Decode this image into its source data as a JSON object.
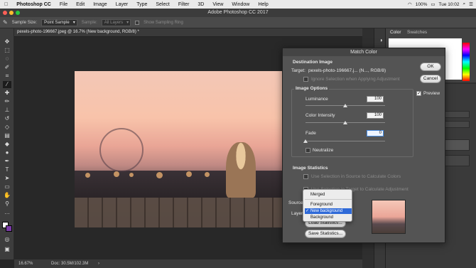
{
  "menubar": {
    "apple": "",
    "app_name": "Photoshop CC",
    "items": [
      "File",
      "Edit",
      "Image",
      "Layer",
      "Type",
      "Select",
      "Filter",
      "3D",
      "View",
      "Window",
      "Help"
    ],
    "battery": "100%",
    "clock": "Tue 10:02"
  },
  "window": {
    "title": "Adobe Photoshop CC 2017"
  },
  "options_bar": {
    "sample_size_label": "Sample Size:",
    "sample_size_value": "Point Sample",
    "sample_label": "Sample:",
    "sample_value": "All Layers",
    "sampling_ring_label": "Show Sampling Ring"
  },
  "document": {
    "tab_title": "pexels-photo-196667.jpeg @ 16.7% (New background, RGB/8) *",
    "zoom": "16.67%",
    "doc_size": "Doc: 30.5M/102.3M"
  },
  "panels": {
    "color_tab": "Color",
    "swatches_tab": "Swatches"
  },
  "dialog": {
    "title": "Match Color",
    "destination_heading": "Destination Image",
    "target_label": "Target:",
    "target_value": "pexels-photo-196667.j... (N..., RGB/8)",
    "ignore_selection_label": "Ignore Selection when Applying Adjustment",
    "image_options_heading": "Image Options",
    "luminance_label": "Luminance",
    "luminance_value": "100",
    "luminance_fraction": 0.5,
    "intensity_label": "Color Intensity",
    "intensity_value": "100",
    "intensity_fraction": 0.5,
    "fade_label": "Fade",
    "fade_value": "0",
    "fade_fraction": 0,
    "neutralize_label": "Neutralize",
    "image_stats_heading": "Image Statistics",
    "use_sel_source_label": "Use Selection in Source to Calculate Colors",
    "use_sel_target_label": "Use Selection in Target to Calculate Adjustment",
    "source_label": "Source",
    "layer_label": "Layer",
    "load_stats_label": "Load Statistics...",
    "save_stats_label": "Save Statistics...",
    "ok_label": "OK",
    "cancel_label": "Cancel",
    "preview_label": "Preview",
    "preview_checked": true
  },
  "layer_popup": {
    "items": [
      "Merged",
      "Foreground",
      "New background",
      "Background"
    ],
    "selected": "New background"
  }
}
